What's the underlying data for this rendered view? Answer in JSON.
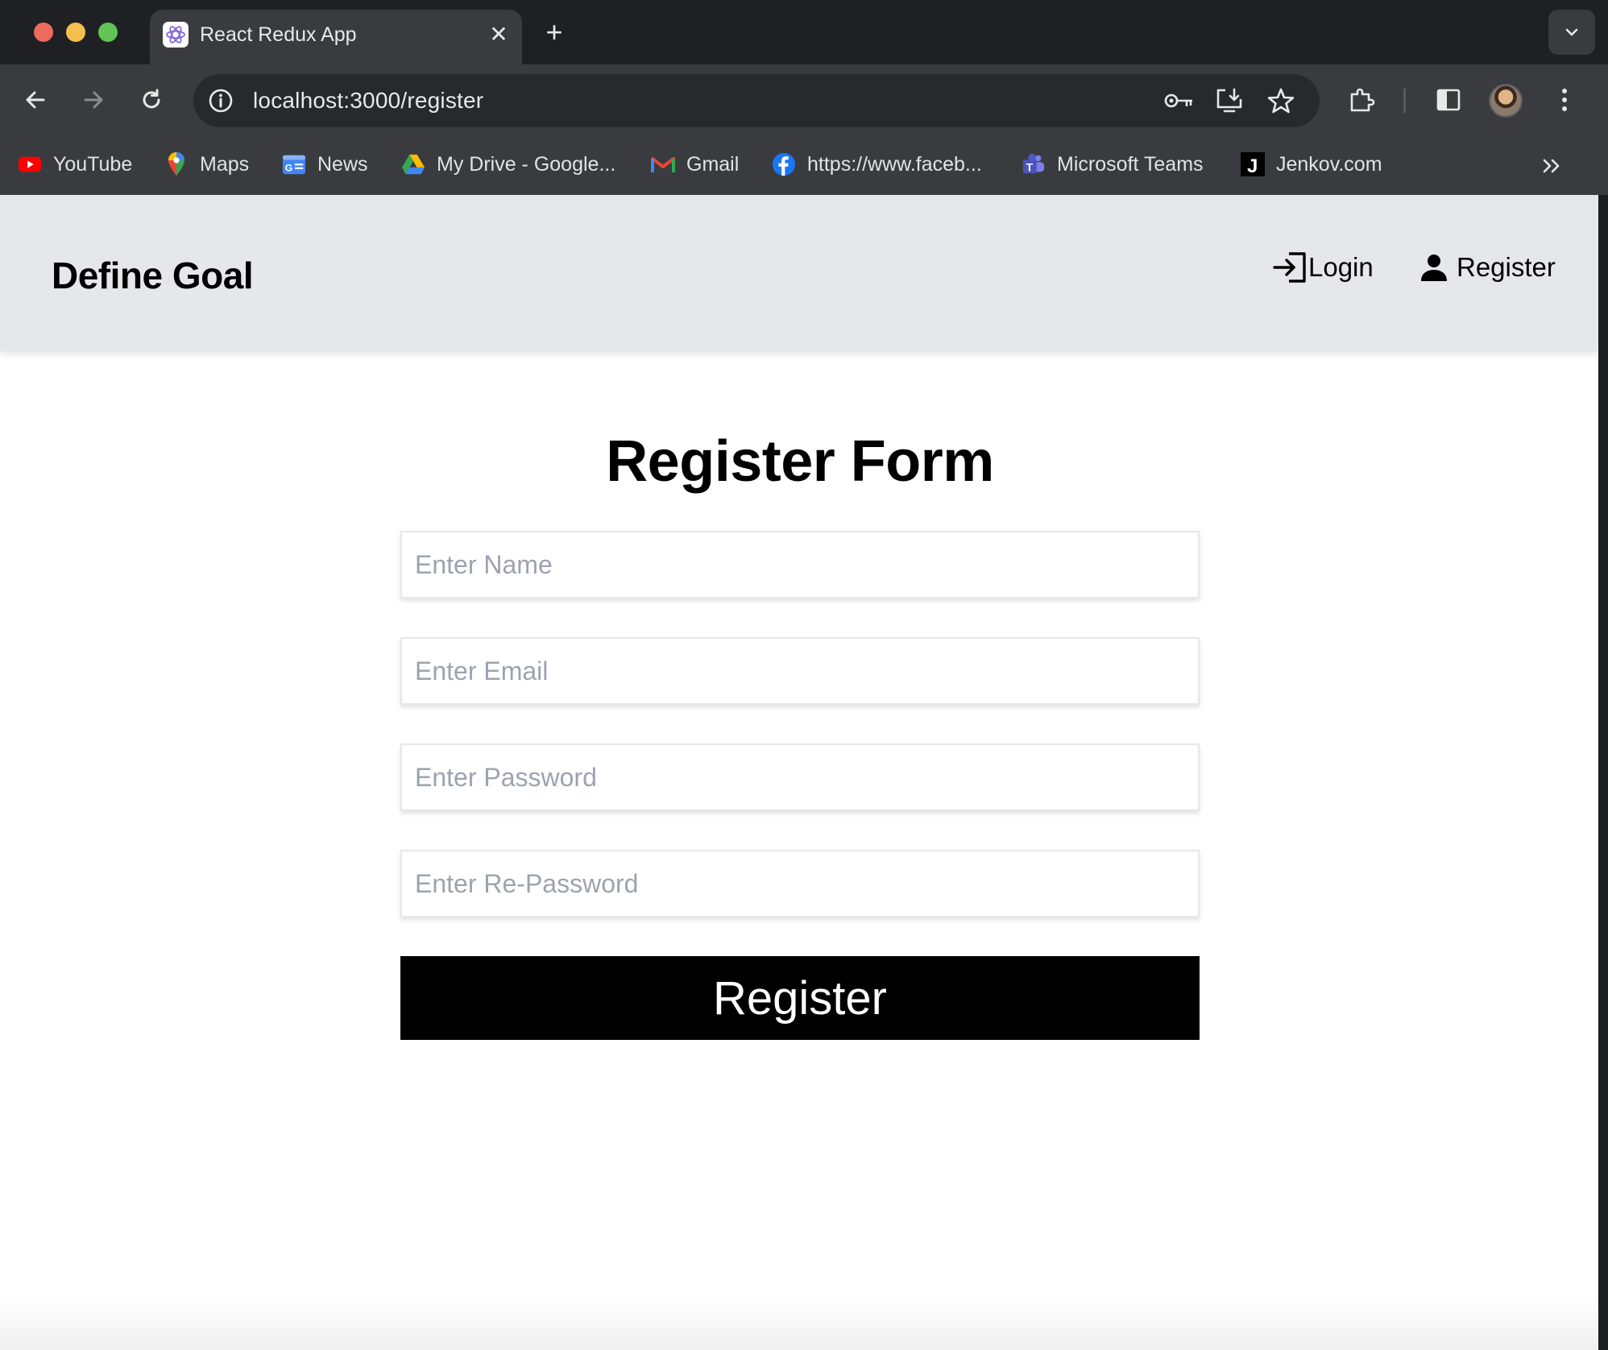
{
  "browser": {
    "tab_title": "React Redux App",
    "url": "localhost:3000/register",
    "bookmarks": [
      {
        "label": "YouTube",
        "icon": "youtube-icon"
      },
      {
        "label": "Maps",
        "icon": "maps-icon"
      },
      {
        "label": "News",
        "icon": "news-icon"
      },
      {
        "label": "My Drive - Google...",
        "icon": "drive-icon"
      },
      {
        "label": "Gmail",
        "icon": "gmail-icon"
      },
      {
        "label": "https://www.faceb...",
        "icon": "facebook-icon"
      },
      {
        "label": "Microsoft Teams",
        "icon": "teams-icon"
      },
      {
        "label": "Jenkov.com",
        "icon": "jenkov-icon"
      }
    ],
    "colors": {
      "titlebar": "#1f2023",
      "toolbar": "#3a3b3f",
      "omnibox": "#28292c",
      "close": "#ed6a5e",
      "minimize": "#f5bf4f",
      "maximize": "#61c454"
    }
  },
  "app": {
    "brand": "Define Goal",
    "nav": {
      "login": "Login",
      "register": "Register"
    },
    "form": {
      "title": "Register Form",
      "name_placeholder": "Enter Name",
      "email_placeholder": "Enter Email",
      "password_placeholder": "Enter Password",
      "repassword_placeholder": "Enter Re-Password",
      "submit_label": "Register"
    },
    "colors": {
      "header_bg": "#e5e7eb",
      "button_bg": "#000000",
      "button_text": "#ffffff"
    }
  }
}
